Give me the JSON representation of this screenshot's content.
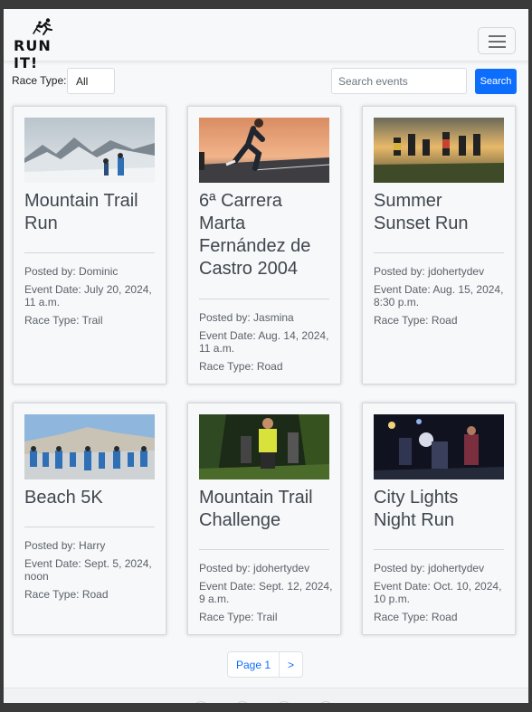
{
  "brand": {
    "name": "RUN IT!"
  },
  "filter": {
    "label": "Race Type:",
    "selected": "All"
  },
  "search": {
    "placeholder": "Search events",
    "button_label": "Search"
  },
  "events": [
    {
      "title_lines": [
        "Mountain Trail",
        "Run"
      ],
      "posted_by": "Posted by: Dominic",
      "date_lines": [
        "Event Date: July 20, 2024,",
        "11 a.m."
      ],
      "race_type": "Race Type: Trail",
      "image": "snowy-mountain-runners"
    },
    {
      "title_lines": [
        "6ª Carrera",
        "Marta",
        "Fernández de",
        "Castro 2004"
      ],
      "posted_by": "Posted by: Jasmina",
      "date_lines": [
        "Event Date: Aug. 14, 2024,",
        "11 a.m."
      ],
      "race_type": "Race Type: Road",
      "image": "road-runner-sunset"
    },
    {
      "title_lines": [
        "Summer",
        "Sunset Run"
      ],
      "posted_by": "Posted by: jdohertydev",
      "date_lines": [
        "Event Date: Aug. 15, 2024,",
        "8:30 p.m."
      ],
      "race_type": "Race Type: Road",
      "image": "group-jumping-sunset"
    },
    {
      "title_lines": [
        "Beach 5K"
      ],
      "posted_by": "Posted by: Harry",
      "date_lines": [
        "Event Date: Sept. 5, 2024,",
        "noon"
      ],
      "race_type": "Race Type: Road",
      "image": "beach-crowd-race"
    },
    {
      "title_lines": [
        "Mountain Trail",
        "Challenge"
      ],
      "posted_by": "Posted by: jdohertydev",
      "date_lines": [
        "Event Date: Sept. 12, 2024,",
        "9 a.m."
      ],
      "race_type": "Race Type: Trail",
      "image": "forest-trail-runners"
    },
    {
      "title_lines": [
        "City Lights",
        "Night Run"
      ],
      "posted_by": "Posted by: jdohertydev",
      "date_lines": [
        "Event Date: Oct. 10, 2024,",
        "10 p.m."
      ],
      "race_type": "Race Type: Road",
      "image": "night-city-runners"
    }
  ],
  "pagination": {
    "current": "Page 1",
    "next": ">"
  }
}
